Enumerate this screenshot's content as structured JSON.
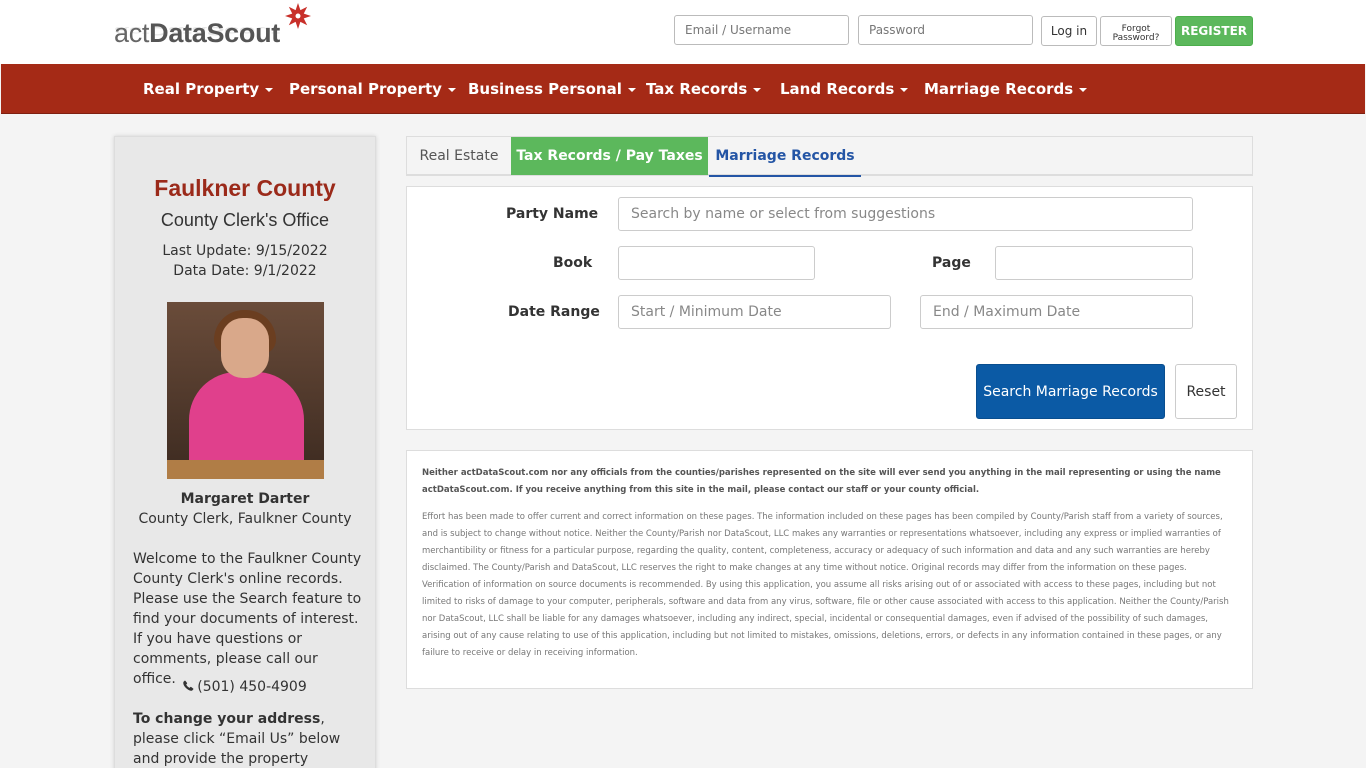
{
  "brand": {
    "logo_pre": "act",
    "logo_bold": "DataScout",
    "logo_post": ""
  },
  "login": {
    "email_placeholder": "Email / Username",
    "password_placeholder": "Password",
    "login_label": "Log in",
    "forgot_label": "Forgot\nPassword?",
    "register_label": "REGISTER"
  },
  "nav": {
    "items": [
      {
        "label": "Real Property"
      },
      {
        "label": "Personal Property"
      },
      {
        "label": "Business Personal"
      },
      {
        "label": "Tax Records"
      },
      {
        "label": "Land Records"
      },
      {
        "label": "Marriage Records"
      }
    ]
  },
  "sidebar": {
    "county": "Faulkner County",
    "office": "County Clerk's Office",
    "last_update": "Last Update: 9/15/2022",
    "data_date": "Data Date: 9/1/2022",
    "person_name": "Margaret Darter",
    "person_title": "County Clerk, Faulkner County",
    "welcome": "Welcome to the Faulkner County County Clerk's online records. Please use the Search feature to find your documents of interest. If you have questions or comments, please call our office.",
    "phone": "(501) 450-4909",
    "change_addr_bold": "To change your address",
    "change_addr_rest": ", please click “Email Us” below and provide the property number, previous"
  },
  "tabs": {
    "real_estate": "Real Estate",
    "tax": "Tax Records / Pay Taxes",
    "marriage": "Marriage Records"
  },
  "form": {
    "party_name_label": "Party Name",
    "party_name_placeholder": "Search by name or select from suggestions",
    "book_label": "Book",
    "page_label": "Page",
    "date_range_label": "Date Range",
    "start_placeholder": "Start / Minimum Date",
    "end_placeholder": "End / Maximum Date",
    "search_label": "Search Marriage Records",
    "reset_label": "Reset"
  },
  "disclaimer": {
    "bold": "Neither actDataScout.com nor any officials from the counties/parishes represented on the site will ever send you anything in the mail representing or using the name actDataScout.com. If you receive anything from this site in the mail, please contact our staff or your county official.",
    "body": "Effort has been made to offer current and correct information on these pages. The information included on these pages has been compiled by County/Parish staff from a variety of sources, and is subject to change without notice. Neither the County/Parish nor DataScout, LLC makes any warranties or representations whatsoever, including any express or implied warranties of merchantibility or fitness for a particular purpose, regarding the quality, content, completeness, accuracy or adequacy of such information and data and any such warranties are hereby disclaimed. The County/Parish and DataScout, LLC reserves the right to make changes at any time without notice. Original records may differ from the information on these pages. Verification of information on source documents is recommended. By using this application, you assume all risks arising out of or associated with access to these pages, including but not limited to risks of damage to your computer, peripherals, software and data from any virus, software, file or other cause associated with access to this application. Neither the County/Parish nor DataScout, LLC shall be liable for any damages whatsoever, including any indirect, special, incidental or consequential damages, even if advised of the possibility of such damages, arising out of any cause relating to use of this application, including but not limited to mistakes, omissions, deletions, errors, or defects in any information contained in these pages, or any failure to receive or delay in receiving information."
  },
  "colors": {
    "nav_bg": "#a52a16",
    "accent_green": "#5cb85c",
    "accent_blue": "#0b5aa5",
    "county_red": "#9b2a1a"
  },
  "icons": {
    "phone": "phone-icon",
    "caret": "caret-down-icon",
    "logo_star": "logo-star-icon"
  }
}
